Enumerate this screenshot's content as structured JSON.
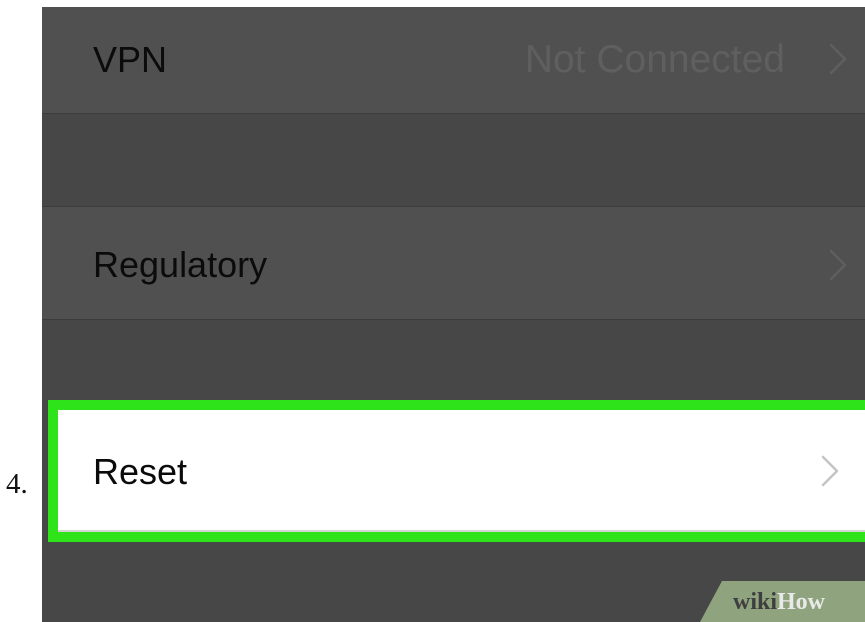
{
  "step_number": "4.",
  "settings": {
    "rows": [
      {
        "label": "VPN",
        "value": "Not Connected",
        "chevron": "chevron-right-icon"
      },
      {
        "label": "Regulatory",
        "chevron": "chevron-right-icon"
      },
      {
        "label": "Reset",
        "chevron": "chevron-right-icon",
        "highlighted": true
      }
    ]
  },
  "watermark": {
    "part1": "wiki",
    "part2": "How"
  },
  "colors": {
    "screen_background": "#474747",
    "row_background": "#505050",
    "highlight_border": "#2ee31a",
    "highlight_row": "#ffffff"
  }
}
